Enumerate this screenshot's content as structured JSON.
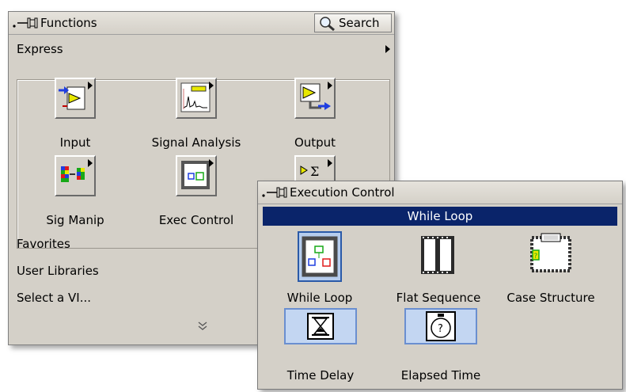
{
  "functions_palette": {
    "title": "Functions",
    "search_label": "Search",
    "express_label": "Express",
    "icons": [
      {
        "label": "Input",
        "icon": "express-input-icon"
      },
      {
        "label": "Signal Analysis",
        "icon": "signal-analysis-icon"
      },
      {
        "label": "Output",
        "icon": "express-output-icon"
      },
      {
        "label": "Sig Manip",
        "icon": "signal-manipulation-icon"
      },
      {
        "label": "Exec Control",
        "icon": "execution-control-icon"
      },
      {
        "label": "",
        "icon": "arithmetic-comparison-icon"
      }
    ],
    "menu": [
      "Favorites",
      "User Libraries",
      "Select a VI..."
    ],
    "more_icon": "double-chevron-down-icon"
  },
  "exec_palette": {
    "title": "Execution Control",
    "highlight": "While Loop",
    "icons": [
      {
        "label": "While Loop",
        "icon": "while-loop-icon"
      },
      {
        "label": "Flat Sequence",
        "icon": "flat-sequence-icon"
      },
      {
        "label": "Case Structure",
        "icon": "case-structure-icon"
      },
      {
        "label": "Time Delay",
        "icon": "time-delay-icon"
      },
      {
        "label": "Elapsed Time",
        "icon": "elapsed-time-icon"
      }
    ]
  },
  "colors": {
    "palette_bg": "#d4d0c8",
    "highlight_bar": "#0a246a",
    "selection": "#b6cdee"
  }
}
